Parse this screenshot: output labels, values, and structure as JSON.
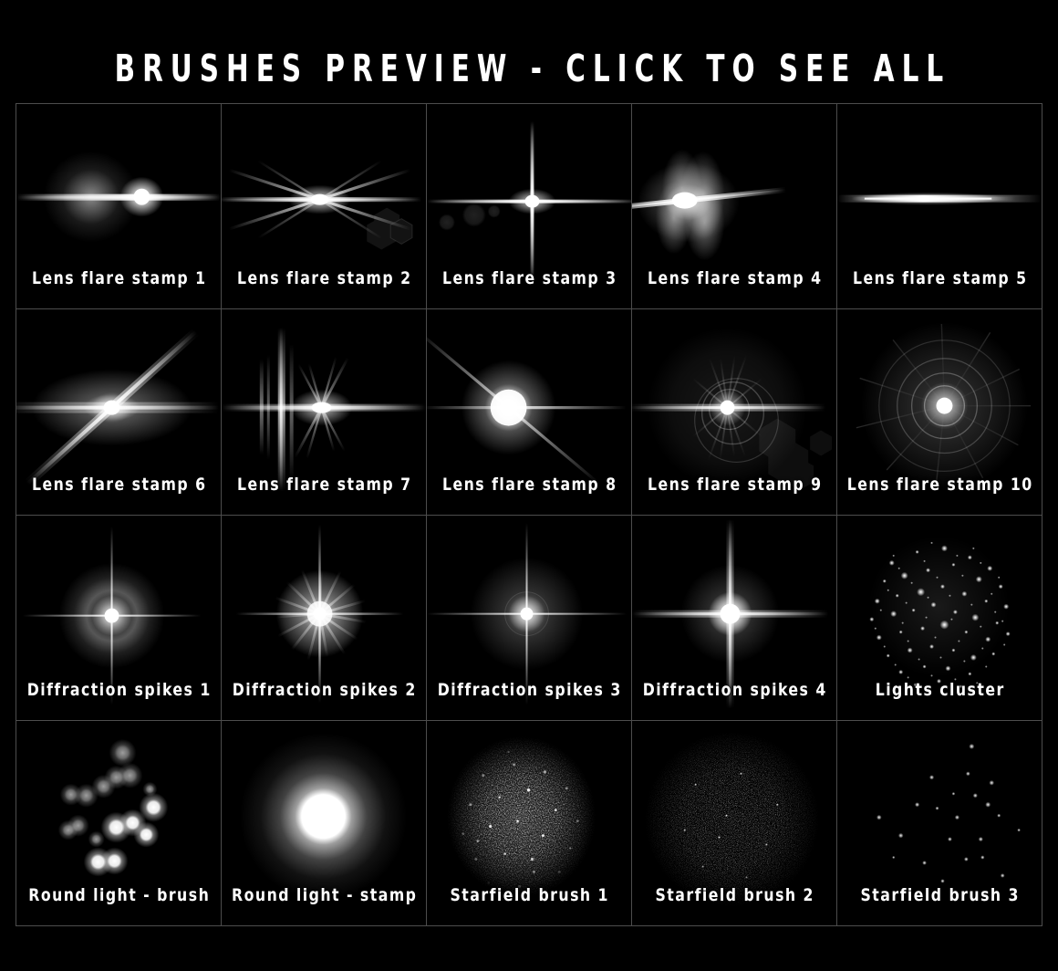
{
  "page": {
    "background_color": "#000000",
    "text_color": "#ffffff",
    "grid_line_color": "#4d4d4d"
  },
  "header": {
    "title": "BRUSHES PREVIEW - CLICK TO SEE ALL"
  },
  "grid": {
    "columns": 5,
    "rows": 4,
    "items": [
      {
        "label": "Lens flare stamp 1",
        "art": "lens-flare-streak-with-orb"
      },
      {
        "label": "Lens flare stamp 2",
        "art": "lens-flare-x-rays-with-ghosts"
      },
      {
        "label": "Lens flare stamp 3",
        "art": "lens-flare-four-point-star-with-orbs"
      },
      {
        "label": "Lens flare stamp 4",
        "art": "lens-flare-broad-glow-twin-lobes"
      },
      {
        "label": "Lens flare stamp 5",
        "art": "lens-flare-horizontal-streak"
      },
      {
        "label": "Lens flare stamp 6",
        "art": "lens-flare-diagonal-streak"
      },
      {
        "label": "Lens flare stamp 7",
        "art": "lens-flare-vertical-bars"
      },
      {
        "label": "Lens flare stamp 8",
        "art": "lens-flare-bright-orb-rays"
      },
      {
        "label": "Lens flare stamp 9",
        "art": "lens-flare-rings-with-hex-ghosts"
      },
      {
        "label": "Lens flare stamp 10",
        "art": "lens-flare-concentric-rings"
      },
      {
        "label": "Diffraction spikes 1",
        "art": "diffraction-cross-with-halo"
      },
      {
        "label": "Diffraction spikes 2",
        "art": "diffraction-radial-burst"
      },
      {
        "label": "Diffraction spikes 3",
        "art": "diffraction-thin-cross"
      },
      {
        "label": "Diffraction spikes 4",
        "art": "diffraction-bold-cross"
      },
      {
        "label": "Lights cluster",
        "art": "lights-cluster-dots"
      },
      {
        "label": "Round light - brush",
        "art": "round-light-scattered-orbs"
      },
      {
        "label": "Round light - stamp",
        "art": "round-light-single-orb"
      },
      {
        "label": "Starfield brush 1",
        "art": "starfield-dense-cluster"
      },
      {
        "label": "Starfield brush 2",
        "art": "starfield-fine-noise"
      },
      {
        "label": "Starfield brush 3",
        "art": "starfield-sparse-large"
      }
    ]
  }
}
